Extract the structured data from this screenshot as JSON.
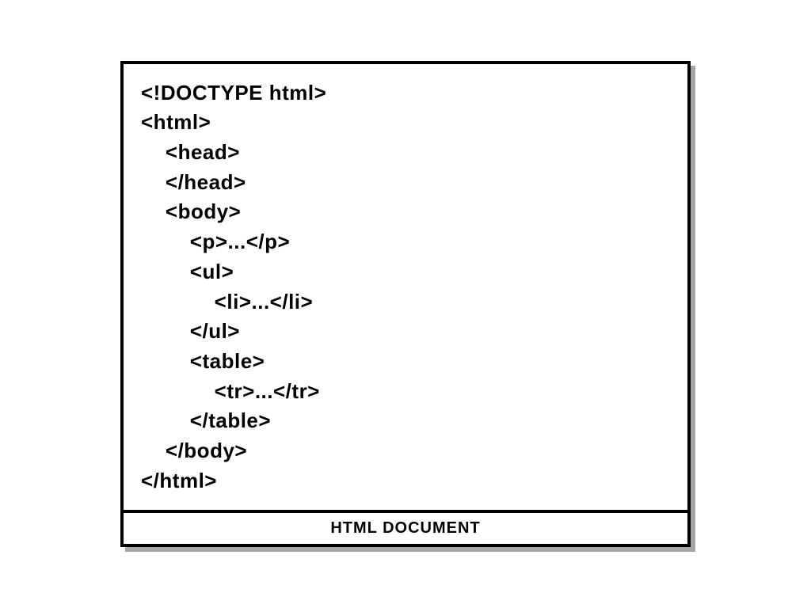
{
  "code": {
    "lines": [
      "<!DOCTYPE html>",
      "<html>",
      "    <head>",
      "    </head>",
      "    <body>",
      "        <p>...</p>",
      "        <ul>",
      "            <li>...</li>",
      "        </ul>",
      "        <table>",
      "            <tr>...</tr>",
      "        </table>",
      "    </body>",
      "</html>"
    ]
  },
  "caption": "HTML DOCUMENT"
}
